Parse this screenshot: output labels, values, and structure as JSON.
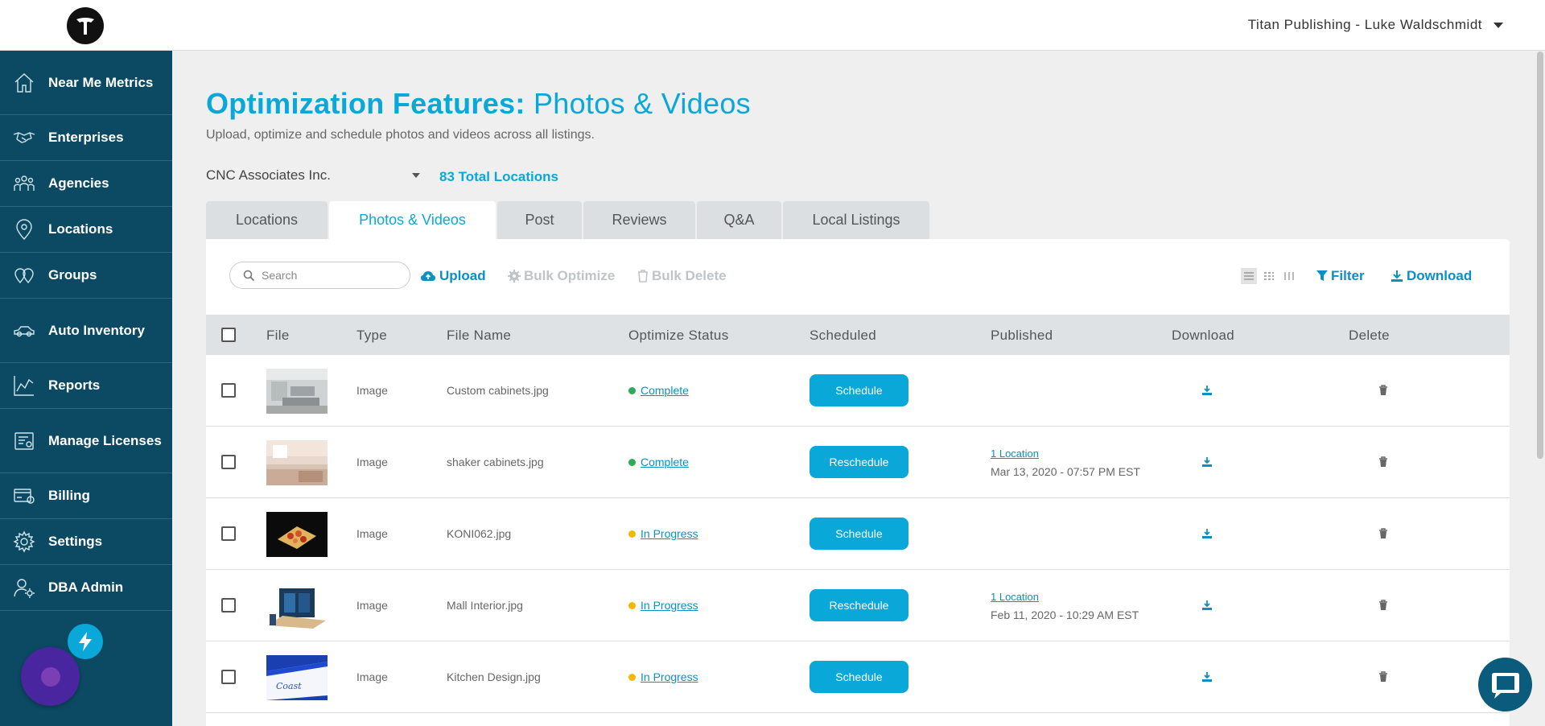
{
  "header": {
    "user_menu": "Titan Publishing - Luke Waldschmidt"
  },
  "sidebar": {
    "items": [
      {
        "label": "Near Me Metrics",
        "icon": "home-icon"
      },
      {
        "label": "Enterprises",
        "icon": "handshake-icon"
      },
      {
        "label": "Agencies",
        "icon": "team-icon"
      },
      {
        "label": "Locations",
        "icon": "map-pin-icon"
      },
      {
        "label": "Groups",
        "icon": "pins-icon"
      },
      {
        "label": "Auto Inventory",
        "icon": "car-icon"
      },
      {
        "label": "Reports",
        "icon": "chart-icon"
      },
      {
        "label": "Manage Licenses",
        "icon": "license-icon"
      },
      {
        "label": "Billing",
        "icon": "billing-icon"
      },
      {
        "label": "Settings",
        "icon": "gear-icon"
      },
      {
        "label": "DBA Admin",
        "icon": "admin-icon"
      }
    ]
  },
  "page": {
    "title_bold": "Optimization Features:",
    "title_light": "Photos & Videos",
    "subtitle": "Upload, optimize and schedule photos and videos across all listings.",
    "company": "CNC Associates Inc.",
    "total_locations": "83 Total Locations"
  },
  "tabs": [
    {
      "label": "Locations",
      "active": false
    },
    {
      "label": "Photos & Videos",
      "active": true
    },
    {
      "label": "Post",
      "active": false
    },
    {
      "label": "Reviews",
      "active": false
    },
    {
      "label": "Q&A",
      "active": false
    },
    {
      "label": "Local Listings",
      "active": false
    }
  ],
  "toolbar": {
    "search_placeholder": "Search",
    "upload": "Upload",
    "bulk_optimize": "Bulk Optimize",
    "bulk_delete": "Bulk Delete",
    "filter": "Filter",
    "download": "Download"
  },
  "table": {
    "columns": [
      "File",
      "Type",
      "File Name",
      "Optimize Status",
      "Scheduled",
      "Published",
      "Download",
      "Delete"
    ],
    "rows": [
      {
        "type": "Image",
        "file_name": "Custom cabinets.jpg",
        "status": "Complete",
        "status_color": "#2eaa5b",
        "schedule_label": "Schedule",
        "published_link": "",
        "published_date": ""
      },
      {
        "type": "Image",
        "file_name": "shaker cabinets.jpg",
        "status": "Complete",
        "status_color": "#2eaa5b",
        "schedule_label": "Reschedule",
        "published_link": "1 Location",
        "published_date": "Mar 13, 2020 - 07:57 PM EST"
      },
      {
        "type": "Image",
        "file_name": "KONI062.jpg",
        "status": "In Progress",
        "status_color": "#f5b800",
        "schedule_label": "Schedule",
        "published_link": "",
        "published_date": ""
      },
      {
        "type": "Image",
        "file_name": "Mall Interior.jpg",
        "status": "In Progress",
        "status_color": "#f5b800",
        "schedule_label": "Reschedule",
        "published_link": "1 Location",
        "published_date": "Feb 11, 2020 - 10:29 AM EST"
      },
      {
        "type": "Image",
        "file_name": "Kitchen Design.jpg",
        "status": "In Progress",
        "status_color": "#f5b800",
        "schedule_label": "Schedule",
        "published_link": "",
        "published_date": ""
      }
    ]
  },
  "colors": {
    "accent": "#0aa7d9",
    "sidebar": "#0c4a64"
  }
}
